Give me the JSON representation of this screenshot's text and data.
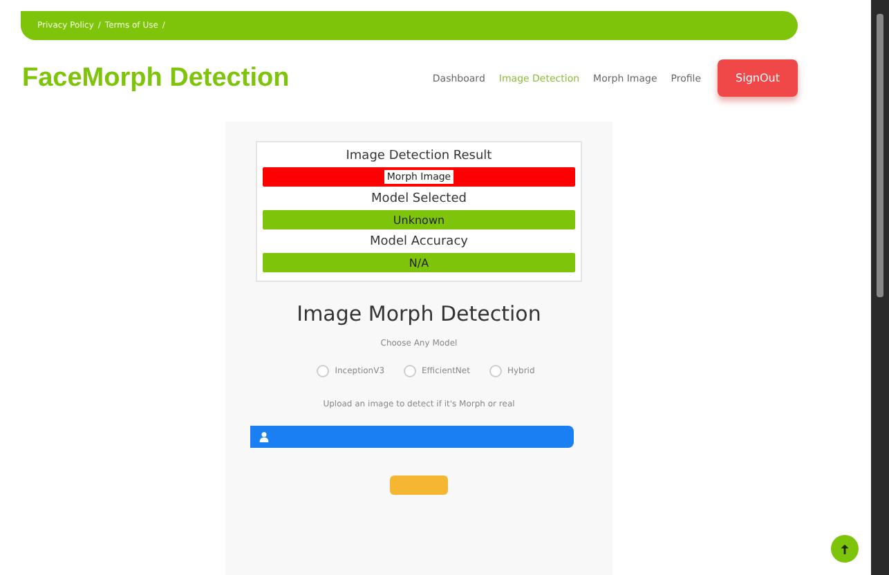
{
  "breadcrumb": [
    "Privacy Policy",
    "Terms of Use"
  ],
  "breadcrumb_separator": "/",
  "brand": "FaceMorph Detection",
  "nav": [
    {
      "label": "Dashboard",
      "selected": false
    },
    {
      "label": "Image Detection",
      "selected": true
    },
    {
      "label": "Morph Image",
      "selected": false
    },
    {
      "label": "Profile",
      "selected": false
    }
  ],
  "signout": "SignOut",
  "result": {
    "rows": [
      {
        "label": "Image Detection Result",
        "value": "Morph Image",
        "color": "#ff0000"
      },
      {
        "label": "Model Selected",
        "value": "Unknown",
        "color": "#7ec40a"
      },
      {
        "label": "Model Accuracy",
        "value": "N/A",
        "color": "#7ec40a"
      }
    ]
  },
  "form": {
    "title": "Image Morph Detection",
    "subtitle": "Choose Any Model",
    "models": [
      {
        "label": "InceptionV3",
        "selected": false
      },
      {
        "label": "EfficientNet",
        "selected": false
      },
      {
        "label": "Hybrid",
        "selected": false
      }
    ],
    "upload_hint": "Upload an image to detect if it's Morph or real"
  }
}
